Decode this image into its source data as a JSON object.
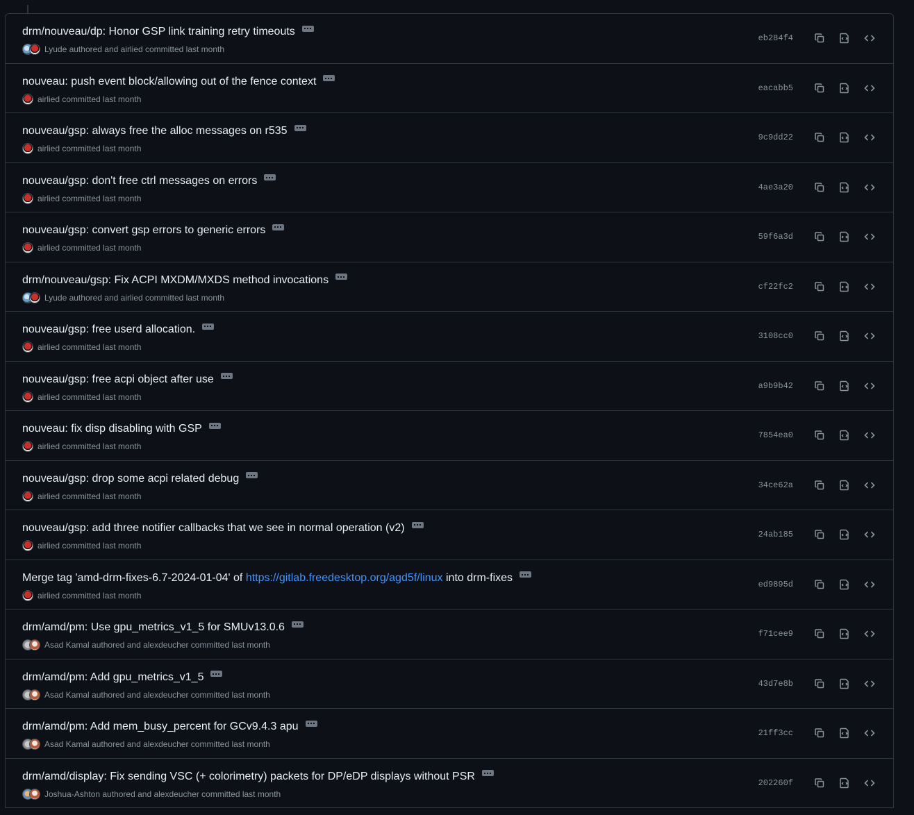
{
  "commits": [
    {
      "title": "drm/nouveau/dp: Honor GSP link training retry timeouts",
      "meta": "Lyude authored and airlied committed last month",
      "sha": "eb284f4",
      "avatars": [
        "lyude",
        "redhat"
      ]
    },
    {
      "title": "nouveau: push event block/allowing out of the fence context",
      "meta": "airlied committed last month",
      "sha": "eacabb5",
      "avatars": [
        "redhat"
      ]
    },
    {
      "title": "nouveau/gsp: always free the alloc messages on r535",
      "meta": "airlied committed last month",
      "sha": "9c9dd22",
      "avatars": [
        "redhat"
      ]
    },
    {
      "title": "nouveau/gsp: don't free ctrl messages on errors",
      "meta": "airlied committed last month",
      "sha": "4ae3a20",
      "avatars": [
        "redhat"
      ]
    },
    {
      "title": "nouveau/gsp: convert gsp errors to generic errors",
      "meta": "airlied committed last month",
      "sha": "59f6a3d",
      "avatars": [
        "redhat"
      ]
    },
    {
      "title": "drm/nouveau/gsp: Fix ACPI MXDM/MXDS method invocations",
      "meta": "Lyude authored and airlied committed last month",
      "sha": "cf22fc2",
      "avatars": [
        "lyude",
        "redhat"
      ]
    },
    {
      "title": "nouveau/gsp: free userd allocation.",
      "meta": "airlied committed last month",
      "sha": "3108cc0",
      "avatars": [
        "redhat"
      ]
    },
    {
      "title": "nouveau/gsp: free acpi object after use",
      "meta": "airlied committed last month",
      "sha": "a9b9b42",
      "avatars": [
        "redhat"
      ]
    },
    {
      "title": "nouveau: fix disp disabling with GSP",
      "meta": "airlied committed last month",
      "sha": "7854ea0",
      "avatars": [
        "redhat"
      ]
    },
    {
      "title": "nouveau/gsp: drop some acpi related debug",
      "meta": "airlied committed last month",
      "sha": "34ce62a",
      "avatars": [
        "redhat"
      ]
    },
    {
      "title": "nouveau/gsp: add three notifier callbacks that we see in normal operation (v2)",
      "meta": "airlied committed last month",
      "sha": "24ab185",
      "avatars": [
        "redhat"
      ]
    },
    {
      "title_prefix": "Merge tag 'amd-drm-fixes-6.7-2024-01-04' of ",
      "title_link": "https://gitlab.freedesktop.org/agd5f/linux",
      "title_suffix": " into drm-fixes",
      "meta": "airlied committed last month",
      "sha": "ed9895d",
      "avatars": [
        "redhat"
      ]
    },
    {
      "title": "drm/amd/pm: Use gpu_metrics_v1_5 for SMUv13.0.6",
      "meta": "Asad Kamal authored and alexdeucher committed last month",
      "sha": "f71cee9",
      "avatars": [
        "asad",
        "alex"
      ]
    },
    {
      "title": "drm/amd/pm: Add gpu_metrics_v1_5",
      "meta": "Asad Kamal authored and alexdeucher committed last month",
      "sha": "43d7e8b",
      "avatars": [
        "asad",
        "alex"
      ]
    },
    {
      "title": "drm/amd/pm: Add mem_busy_percent for GCv9.4.3 apu",
      "meta": "Asad Kamal authored and alexdeucher committed last month",
      "sha": "21ff3cc",
      "avatars": [
        "asad",
        "alex"
      ]
    },
    {
      "title": "drm/amd/display: Fix sending VSC (+ colorimetry) packets for DP/eDP displays without PSR",
      "meta": "Joshua-Ashton authored and alexdeucher committed last month",
      "sha": "202260f",
      "avatars": [
        "josh",
        "alex"
      ]
    }
  ],
  "icons": {
    "copy": "copy-icon",
    "diff": "file-diff-icon",
    "browse": "code-icon"
  }
}
